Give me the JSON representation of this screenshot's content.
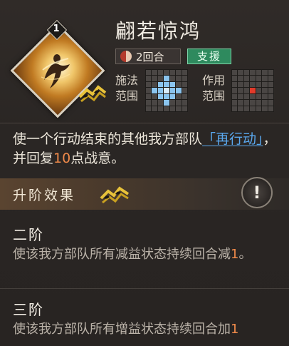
{
  "skill": {
    "name": "翩若惊鸿",
    "level": "1",
    "rounds": "2回合",
    "type_tag": "支援",
    "cast_range_label": [
      "施法",
      "范围"
    ],
    "effect_range_label": [
      "作用",
      "范围"
    ],
    "cast_pattern": [
      [
        0,
        0,
        0,
        0,
        0,
        0,
        0
      ],
      [
        0,
        0,
        0,
        1,
        0,
        0,
        0
      ],
      [
        0,
        0,
        1,
        1,
        1,
        0,
        0
      ],
      [
        0,
        1,
        1,
        2,
        1,
        1,
        0
      ],
      [
        0,
        0,
        1,
        1,
        1,
        0,
        0
      ],
      [
        0,
        0,
        0,
        1,
        0,
        0,
        0
      ],
      [
        0,
        0,
        0,
        0,
        0,
        0,
        0
      ]
    ],
    "effect_pattern": [
      [
        0,
        0,
        0,
        0,
        0,
        0,
        0
      ],
      [
        0,
        0,
        0,
        0,
        0,
        0,
        0
      ],
      [
        0,
        0,
        0,
        0,
        0,
        0,
        0
      ],
      [
        0,
        0,
        0,
        1,
        0,
        0,
        0
      ],
      [
        0,
        0,
        0,
        0,
        0,
        0,
        0
      ],
      [
        0,
        0,
        0,
        0,
        0,
        0,
        0
      ],
      [
        0,
        0,
        0,
        0,
        0,
        0,
        0
      ]
    ]
  },
  "description": {
    "part1": "使一个行动结束的其他我方部队",
    "keyword": "「再行动」",
    "part2": "，并回复",
    "number": "10",
    "part3": "点战意。"
  },
  "upgrade": {
    "title": "升阶效果",
    "info_icon": "!",
    "stages": [
      {
        "title": "二阶",
        "text": "使该我方部队所有减益状态持续回合减",
        "number": "1",
        "suffix": "。"
      },
      {
        "title": "三阶",
        "text": "使该我方部队所有增益状态持续回合",
        "tail": "加",
        "number": "1"
      }
    ]
  },
  "colors": {
    "support_green": "#2e8a5e",
    "keyword_blue": "#5aa8ee",
    "number_orange": "#f08a4a"
  }
}
